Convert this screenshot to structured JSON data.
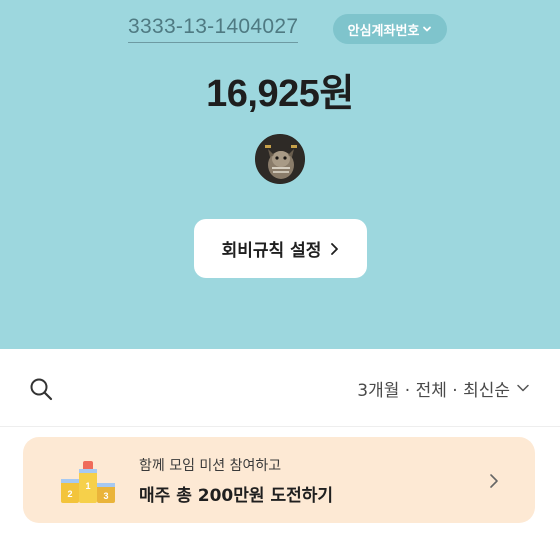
{
  "header": {
    "account_number": "3333-13-1404027",
    "safe_account_label": "안심계좌번호",
    "balance": "16,925원",
    "rule_button_label": "회비규칙 설정"
  },
  "filter": {
    "label": "3개월 · 전체 · 최신순"
  },
  "mission_banner": {
    "subtitle": "함께 모임 미션 참여하고",
    "title": "매주 총 200만원 도전하기",
    "podium_numbers": [
      "2",
      "1",
      "3"
    ]
  },
  "colors": {
    "header_bg": "#9dd7de",
    "safe_button_bg": "#7fc4cc",
    "banner_bg": "#fde9d4"
  },
  "icons": [
    "chevron-down-icon",
    "chevron-right-icon",
    "search-icon",
    "podium-icon"
  ]
}
